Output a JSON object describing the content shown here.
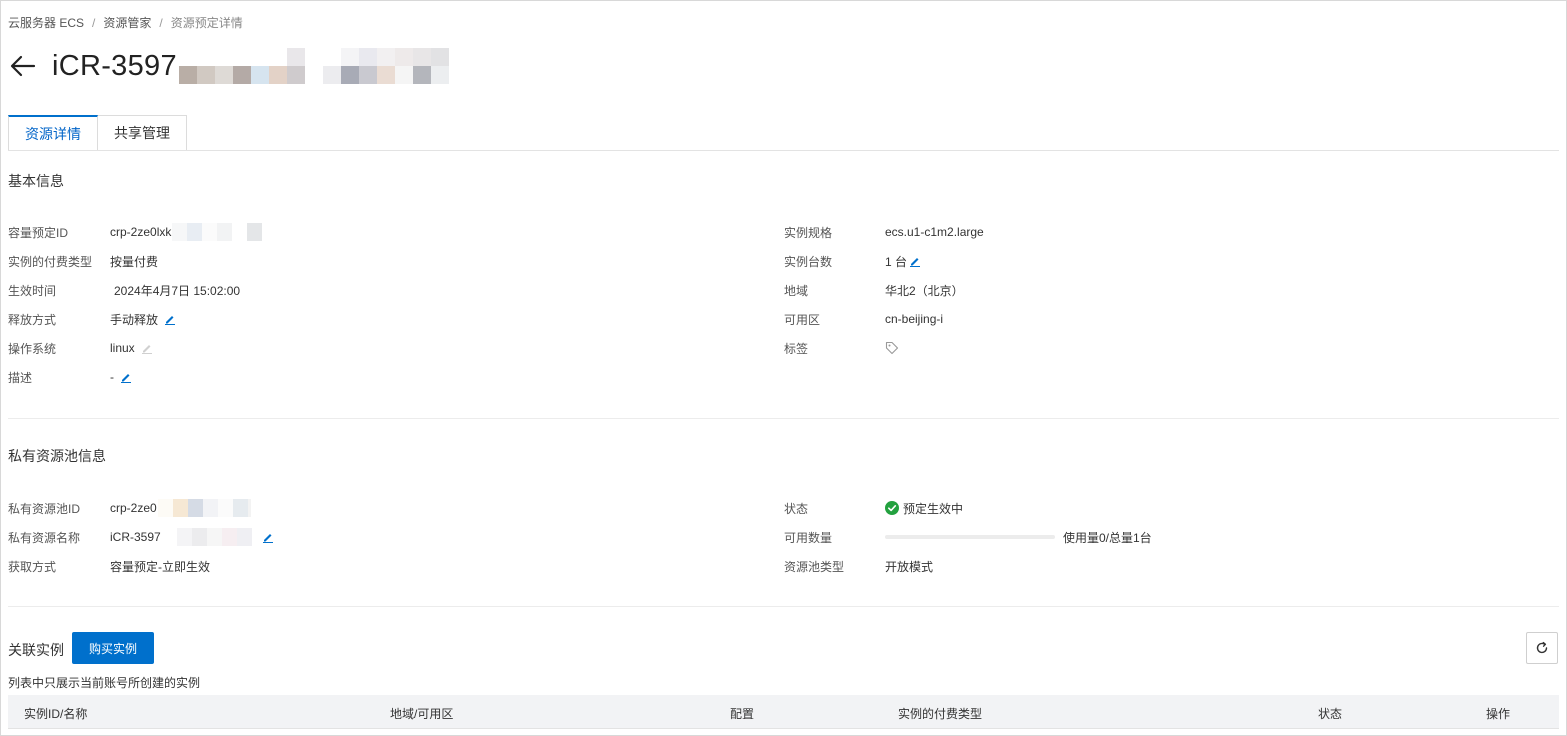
{
  "breadcrumb": {
    "items": [
      "云服务器 ECS",
      "资源管家",
      "资源预定详情"
    ],
    "separator": "/"
  },
  "page": {
    "title": "iCR-3597",
    "back_icon": "arrow-left-icon"
  },
  "tabs": [
    {
      "label": "资源详情",
      "active": true
    },
    {
      "label": "共享管理",
      "active": false
    }
  ],
  "basic_info": {
    "title": "基本信息",
    "left": [
      {
        "label": "容量预定ID",
        "value": "crp-2ze0lxk",
        "masked": true
      },
      {
        "label": "实例的付费类型",
        "value": "按量付费"
      },
      {
        "label": "生效时间",
        "value": "2024年4月7日 15:02:00"
      },
      {
        "label": "释放方式",
        "value": "手动释放",
        "edit": true
      },
      {
        "label": "操作系统",
        "value": "linux",
        "edit": true,
        "edit_disabled": true
      },
      {
        "label": "描述",
        "value": "-",
        "edit": true
      }
    ],
    "right": [
      {
        "label": "实例规格",
        "value": "ecs.u1-c1m2.large"
      },
      {
        "label": "实例台数",
        "value": "1 台",
        "edit": true
      },
      {
        "label": "地域",
        "value": "华北2（北京）"
      },
      {
        "label": "可用区",
        "value": "cn-beijing-i"
      },
      {
        "label": "标签",
        "value": "",
        "icon": "tag-icon"
      }
    ]
  },
  "pool_info": {
    "title": "私有资源池信息",
    "left": [
      {
        "label": "私有资源池ID",
        "value": "crp-2ze0",
        "masked": true
      },
      {
        "label": "私有资源名称",
        "value": "iCR-3597",
        "masked": true,
        "edit": true
      },
      {
        "label": "获取方式",
        "value": "容量预定-立即生效"
      }
    ],
    "right": {
      "status_label": "状态",
      "status_value": "预定生效中",
      "status_color": "#23a13f",
      "available_label": "可用数量",
      "usage_text": "使用量0/总量1台",
      "usage_fraction": 0,
      "pool_type_label": "资源池类型",
      "pool_type_value": "开放模式"
    }
  },
  "instances": {
    "title": "关联实例",
    "buy_button": "购买实例",
    "note": "列表中只展示当前账号所创建的实例",
    "columns": [
      "实例ID/名称",
      "地域/可用区",
      "配置",
      "实例的付费类型",
      "状态",
      "操作"
    ]
  },
  "colors": {
    "accent": "#0070cc",
    "success": "#23a13f"
  }
}
